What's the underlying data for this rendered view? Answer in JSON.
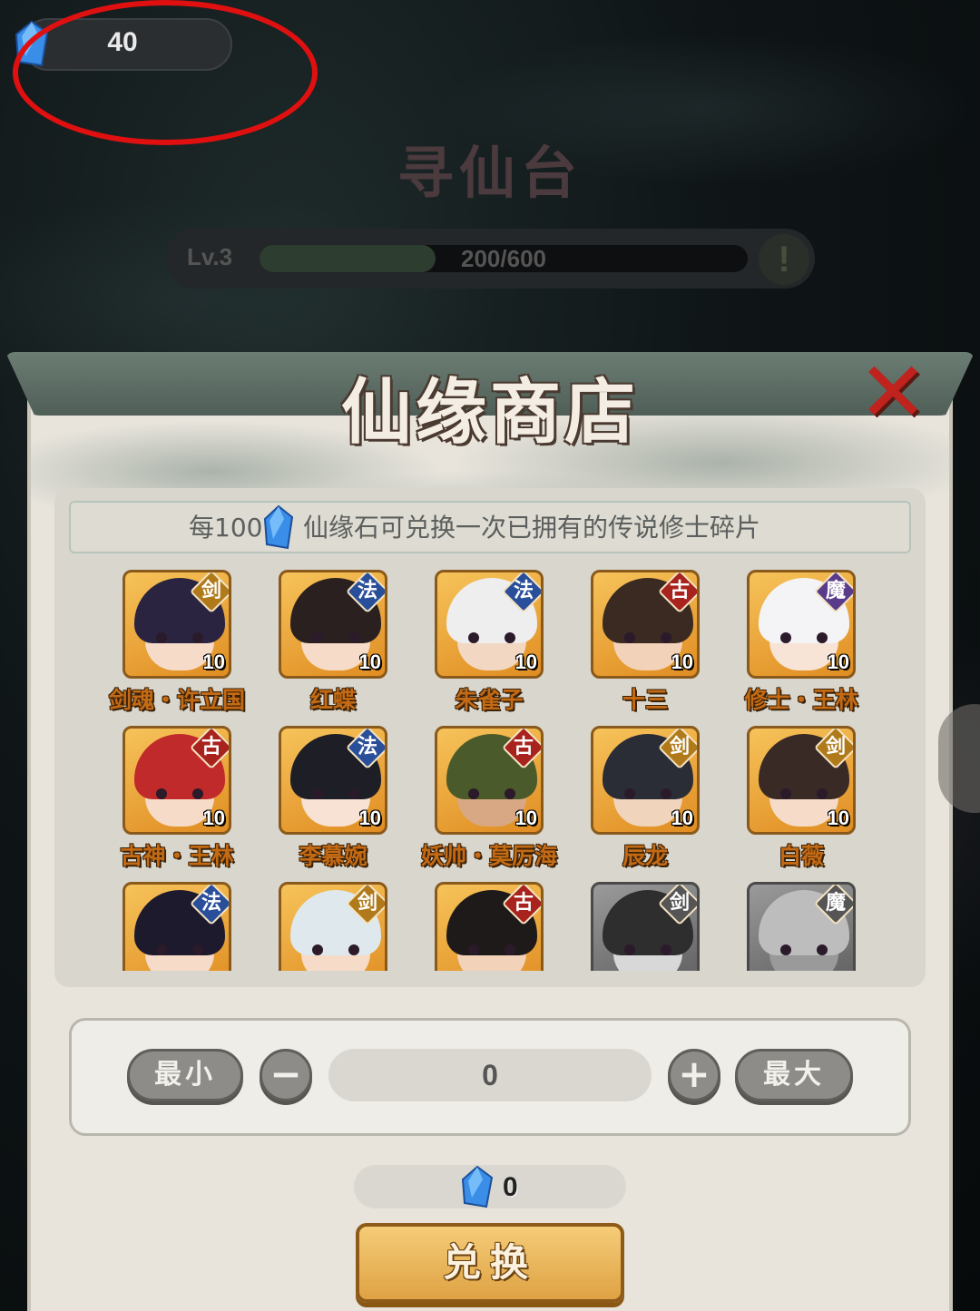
{
  "currency": {
    "amount": "40",
    "icon": "gem-icon"
  },
  "background": {
    "title": "寻仙台",
    "level_label": "Lv.3",
    "progress_text": "200/600",
    "progress_fraction": 0.36,
    "info_icon": "exclamation-icon"
  },
  "shop": {
    "title": "仙缘商店",
    "close_icon": "close-icon",
    "notice_prefix": "每100",
    "notice_suffix": "仙缘石可兑换一次已拥有的传说修士碎片",
    "heroes": [
      {
        "name": "剑魂・许立国",
        "tag": "剑",
        "count": "10",
        "tag_color": "#b07a1a",
        "hair": "#2a2440",
        "skin": "#f6dcc8",
        "gray": false
      },
      {
        "name": "红蝶",
        "tag": "法",
        "count": "10",
        "tag_color": "#2a4f9a",
        "hair": "#2a2020",
        "skin": "#f6dcc8",
        "gray": false
      },
      {
        "name": "朱雀子",
        "tag": "法",
        "count": "10",
        "tag_color": "#2a4f9a",
        "hair": "#eeeeee",
        "skin": "#f2d8c2",
        "gray": false
      },
      {
        "name": "十三",
        "tag": "古",
        "count": "10",
        "tag_color": "#a8221e",
        "hair": "#3a2a22",
        "skin": "#f2d2b8",
        "gray": false
      },
      {
        "name": "修士・王林",
        "tag": "魔",
        "count": "10",
        "tag_color": "#5a3a8a",
        "hair": "#f4f4f6",
        "skin": "#f8e4d6",
        "gray": false
      },
      {
        "name": "古神・王林",
        "tag": "古",
        "count": "10",
        "tag_color": "#a8221e",
        "hair": "#c02a2a",
        "skin": "#f6dcc8",
        "gray": false
      },
      {
        "name": "李慕婉",
        "tag": "法",
        "count": "10",
        "tag_color": "#2a4f9a",
        "hair": "#1e1e26",
        "skin": "#f8e2d4",
        "gray": false
      },
      {
        "name": "妖帅・莫厉海",
        "tag": "古",
        "count": "10",
        "tag_color": "#a8221e",
        "hair": "#4a5a2a",
        "skin": "#d8a884",
        "gray": false
      },
      {
        "name": "辰龙",
        "tag": "剑",
        "count": "10",
        "tag_color": "#b07a1a",
        "hair": "#2a2c36",
        "skin": "#f0d4bc",
        "gray": false
      },
      {
        "name": "白薇",
        "tag": "剑",
        "count": "10",
        "tag_color": "#b07a1a",
        "hair": "#3a2a26",
        "skin": "#f6dcc8",
        "gray": false
      },
      {
        "name": "",
        "tag": "法",
        "count": "",
        "tag_color": "#2a4f9a",
        "hair": "#1e1a2e",
        "skin": "#f6dcc8",
        "gray": false
      },
      {
        "name": "",
        "tag": "剑",
        "count": "",
        "tag_color": "#b07a1a",
        "hair": "#dfe8ec",
        "skin": "#f6dcc8",
        "gray": false
      },
      {
        "name": "",
        "tag": "古",
        "count": "",
        "tag_color": "#a8221e",
        "hair": "#1e1a1a",
        "skin": "#f2d2b8",
        "gray": false
      },
      {
        "name": "",
        "tag": "剑",
        "count": "",
        "tag_color": "#555555",
        "hair": "#2e2e2e",
        "skin": "#d8d8d8",
        "gray": true
      },
      {
        "name": "",
        "tag": "魔",
        "count": "",
        "tag_color": "#555555",
        "hair": "#bdbdbd",
        "skin": "#9a9a9a",
        "gray": true
      }
    ],
    "quantity": {
      "min_label": "最小",
      "minus_label": "−",
      "value": "0",
      "plus_label": "+",
      "max_label": "最大"
    },
    "cost_value": "0",
    "exchange_label": "兑换"
  },
  "colors": {
    "annotation_circle": "#e01010",
    "gem": "#3a8ee8",
    "exchange_button": "#dfa244"
  }
}
